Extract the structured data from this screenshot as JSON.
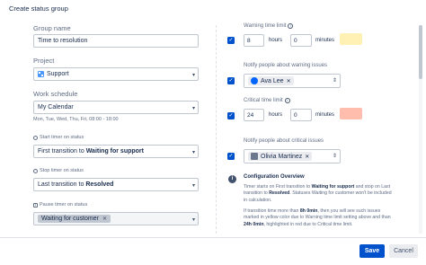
{
  "dialog": {
    "title": "Create status group"
  },
  "left": {
    "group_name_label": "Group name",
    "group_name_value": "Time to resolution",
    "project_label": "Project",
    "project_value": "Support",
    "schedule_label": "Work schedule",
    "schedule_value": "My Calendar",
    "schedule_hours": "Mon, Tue, Wed, Thu, Fri, 08:00 - 18:00",
    "start_label": "Start timer on status",
    "start_prefix": "First transition to",
    "start_status": "Waiting for support",
    "stop_label": "Stop timer on status",
    "stop_prefix": "Last transition to",
    "stop_status": "Resolved",
    "pause_label": "Pause timer on status",
    "pause_value": "Waiting for customer"
  },
  "right": {
    "warning_label": "Warning time limit",
    "warning_hours": "8",
    "warning_minutes": "0",
    "hours_unit": "hours",
    "minutes_unit": "minutes",
    "warning_notify_label": "Notify people about warning issues",
    "warning_person": "Ava Lee",
    "critical_label": "Critical time limit",
    "critical_hours": "24",
    "critical_minutes": "0",
    "critical_notify_label": "Notify people about critical issues",
    "critical_person": "Olivia Martinez",
    "overview_title": "Configuration Overview",
    "overview_p1_a": "Timer starts on First transition to ",
    "overview_p1_b": "Waiting for support",
    "overview_p1_c": " and stop on Last transition to ",
    "overview_p1_d": "Resolved",
    "overview_p1_e": ". Statuses Waiting for customer won't be included in calculation.",
    "overview_p2_a": "If transition time more than ",
    "overview_p2_b": "8h 0min",
    "overview_p2_c": ", then you will see such issues marked in yellow color due to Warning time limit setting above and than ",
    "overview_p2_d": "24h 0min",
    "overview_p2_e": ", highlighted in red due to Critical time limit."
  },
  "footer": {
    "save_label": "Save",
    "cancel_label": "Cancel"
  },
  "colors": {
    "warning_swatch": "#fff0b3",
    "critical_swatch": "#ffbdad",
    "primary": "#0052cc"
  },
  "icons": {
    "project": "project-icon",
    "info": "info-icon",
    "clock": "clock-icon",
    "pause": "pause-icon"
  }
}
